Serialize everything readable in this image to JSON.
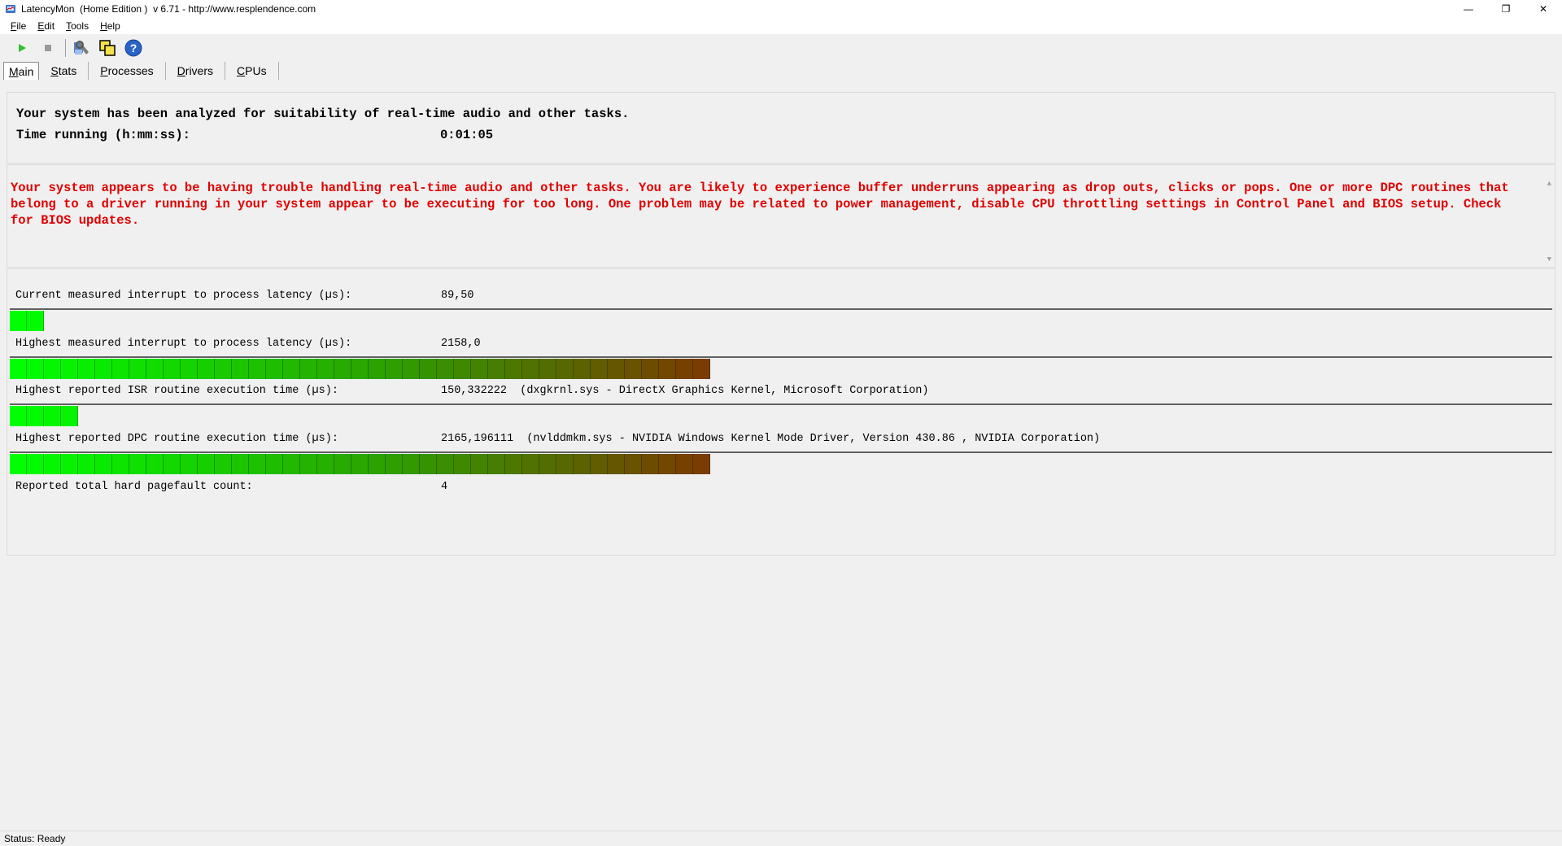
{
  "window": {
    "app_name": "LatencyMon",
    "edition": "(Home Edition )",
    "version": "v 6.71",
    "url": "http://www.resplendence.com",
    "title": "LatencyMon  (Home Edition )  v 6.71 - http://www.resplendence.com",
    "minimize": "—",
    "restore": "❐",
    "close": "✕"
  },
  "menu": [
    {
      "key": "F",
      "rest": "ile"
    },
    {
      "key": "E",
      "rest": "dit"
    },
    {
      "key": "T",
      "rest": "ools"
    },
    {
      "key": "H",
      "rest": "elp"
    }
  ],
  "toolbar": {
    "icons": [
      "play-icon",
      "stop-icon",
      "settings-icon",
      "windows-icon",
      "help-icon"
    ],
    "help_glyph": "?"
  },
  "tabs": [
    {
      "key": "M",
      "rest": "ain",
      "active": true
    },
    {
      "key": "S",
      "rest": "tats",
      "active": false
    },
    {
      "key": "P",
      "rest": "rocesses",
      "active": false
    },
    {
      "key": "D",
      "rest": "rivers",
      "active": false
    },
    {
      "key": "C",
      "rest": "PUs",
      "active": false
    }
  ],
  "summary": {
    "analyzed": "Your system has been analyzed for suitability of real-time audio and other tasks.",
    "time_label": "Time running (h:mm:ss):",
    "time_value": "0:01:05"
  },
  "message": {
    "text": "Your system appears to be having trouble handling real-time audio and other tasks. You are likely to experience buffer underruns appearing as drop outs, clicks or pops. One or more DPC routines that belong to a driver running in your system appear to be executing for too long. One problem may be related to power management, disable CPU throttling settings in Control Panel and BIOS setup. Check for BIOS updates.",
    "color": "#e00000"
  },
  "metrics": {
    "current_latency": {
      "label": "Current measured interrupt to process latency (µs):",
      "value": "89,50",
      "level_segments": 2
    },
    "highest_latency": {
      "label": "Highest measured interrupt to process latency (µs):",
      "value": "2158,0",
      "level_segments": 41
    },
    "isr": {
      "label": "Highest reported ISR routine execution time (µs):",
      "value": "150,332222  (dxgkrnl.sys - DirectX Graphics Kernel, Microsoft Corporation)",
      "level_segments": 4
    },
    "dpc": {
      "label": "Highest reported DPC routine execution time (µs):",
      "value": "2165,196111  (nvlddmkm.sys - NVIDIA Windows Kernel Mode Driver, Version 430.86 , NVIDIA Corporation)",
      "level_segments": 41
    },
    "pagefault": {
      "label": "Reported total hard pagefault count:",
      "value": "4"
    }
  },
  "colors": {
    "bar_start": "#00ff00",
    "bar_mid": "#2e9e00",
    "bar_end": "#7a3c00",
    "accent_red": "#e00000"
  },
  "status": {
    "text": "Status: Ready"
  }
}
